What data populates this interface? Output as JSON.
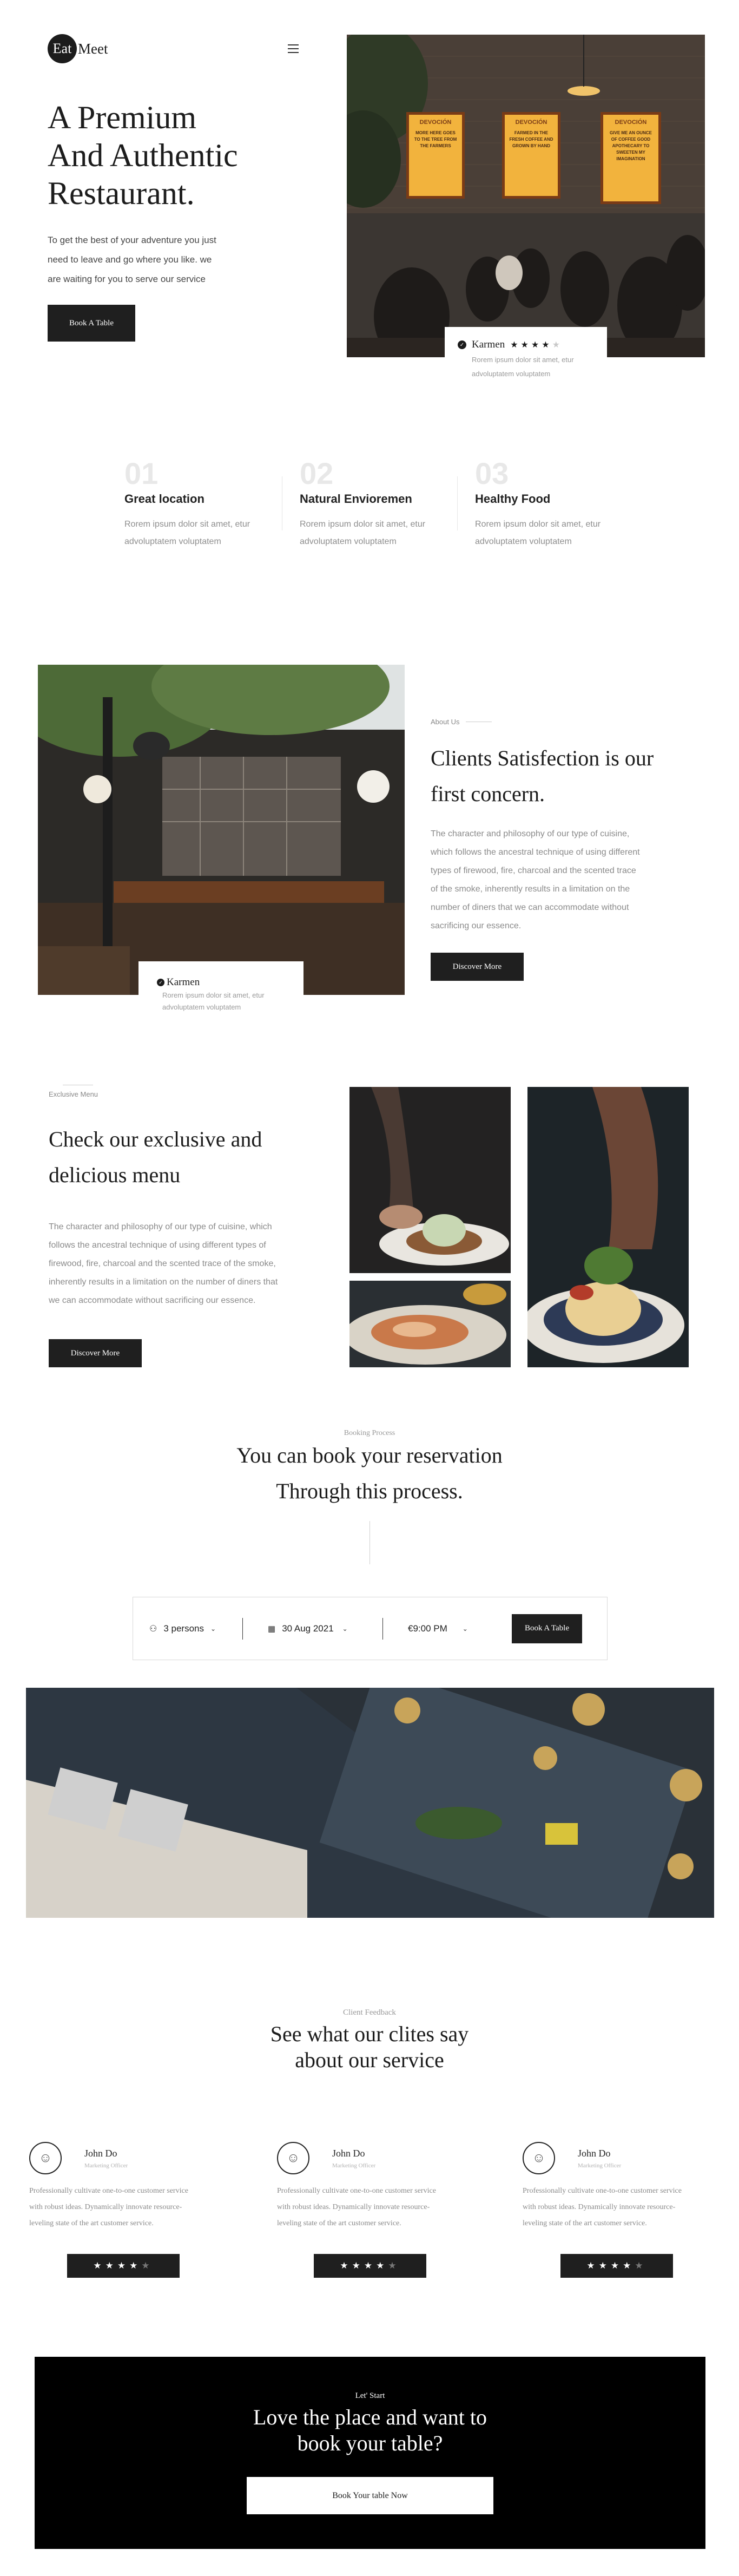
{
  "header": {
    "logo_badge": "Eat",
    "logo_text": "Meet",
    "menu_icon": "hamburger-menu-icon"
  },
  "hero": {
    "title_line1": "A Premium",
    "title_line2": "And Authentic",
    "title_line3": "Restaurant.",
    "subtitle_line1": "To get the best of your adventure you just",
    "subtitle_line2": "need to leave and go where you like. we",
    "subtitle_line3": "are waiting for you to serve our service",
    "cta_label": "Book A Table",
    "review_name": "Karmen",
    "review_text_line1": "Rorem ipsum dolor sit amet, etur",
    "review_text_line2": "advoluptatem voluptatem",
    "review_rating": 4,
    "review_stars": "★★★★★",
    "signs": [
      {
        "title": "DEVOCIÓN",
        "body": "MORE HERE GOES TO THE TREE FROM THE FARMERS"
      },
      {
        "title": "DEVOCIÓN",
        "body": "FARMED IN THE FRESH COFFEE AND GROWN BY HAND"
      },
      {
        "title": "DEVOCIÓN",
        "body": "GIVE ME AN OUNCE OF COFFEE GOOD APOTHECARY TO SWEETEN MY IMAGINATION"
      }
    ]
  },
  "features": [
    {
      "num": "01",
      "title": "Great location",
      "desc_line1": "Rorem ipsum dolor sit amet, etur",
      "desc_line2": "advoluptatem voluptatem"
    },
    {
      "num": "02",
      "title": "Natural Envioremen",
      "desc_line1": "Rorem ipsum dolor sit amet, etur",
      "desc_line2": "advoluptatem voluptatem"
    },
    {
      "num": "03",
      "title": "Healthy Food",
      "desc_line1": "Rorem ipsum dolor sit amet, etur",
      "desc_line2": "advoluptatem voluptatem"
    }
  ],
  "about": {
    "eyebrow": "About Us",
    "title_line1": "Clients Satisfection is our",
    "title_line2": "first concern.",
    "body_lines": [
      "The character and philosophy of our type of cuisine,",
      "which follows the ancestral technique of using different",
      "types of firewood, fire, charcoal and the scented trace",
      "of the smoke, inherently results in a limitation on the",
      "number of diners that we can accommodate without",
      "sacrificing our essence."
    ],
    "cta_label": "Discover More",
    "card_name": "Karmen",
    "card_text_line1": "Rorem ipsum dolor sit amet, etur",
    "card_text_line2": "advoluptatem voluptatem"
  },
  "menu": {
    "eyebrow": "Exclusive Menu",
    "title_line1": "Check our exclusive and",
    "title_line2": "delicious menu",
    "body_lines": [
      "The character and philosophy of our type of cuisine, which",
      "follows the ancestral technique of using different types of",
      "firewood, fire, charcoal and the scented trace of the smoke,",
      "inherently results in a limitation on the number of diners that",
      "we can accommodate without sacrificing our essence."
    ],
    "cta_label": "Discover More"
  },
  "booking": {
    "eyebrow": "Booking Process",
    "title_line1": "You can book your reservation",
    "title_line2": "Through this process.",
    "persons": "3 persons",
    "date": "30 Aug 2021",
    "time": "€9:00 PM",
    "cta_label": "Book A Table"
  },
  "feedback": {
    "eyebrow": "Client Feedback",
    "title_line1": "See what our clites say",
    "title_line2": "about our service",
    "items": [
      {
        "name": "John Do",
        "role": "Marketing Officer",
        "text_line1": "Professionally cultivate one-to-one customer service",
        "text_line2": "with robust ideas. Dynamically innovate resource-",
        "text_line3": "leveling state of the art customer service.",
        "rating": 4,
        "stars": "★★★★★"
      },
      {
        "name": "John Do",
        "role": "Marketing Officer",
        "text_line1": "Professionally cultivate one-to-one customer service",
        "text_line2": "with robust ideas. Dynamically innovate resource-",
        "text_line3": "leveling state of the art customer service.",
        "rating": 4,
        "stars": "★★★★★"
      },
      {
        "name": "John Do",
        "role": "Marketing Officer",
        "text_line1": "Professionally cultivate one-to-one customer service",
        "text_line2": "with robust ideas. Dynamically innovate resource-",
        "text_line3": "leveling state of the art customer service.",
        "rating": 4,
        "stars": "★★★★★"
      }
    ]
  },
  "cta_band": {
    "eyebrow": "Let' Start",
    "title_line1": "Love the place and want to",
    "title_line2": "book your table?",
    "button_label": "Book Your table Now"
  },
  "colors": {
    "dark": "#1f1f1f",
    "sign_yellow": "#f2b33d",
    "sign_border": "#7a3b16",
    "text_gray": "#8a8a8a"
  }
}
